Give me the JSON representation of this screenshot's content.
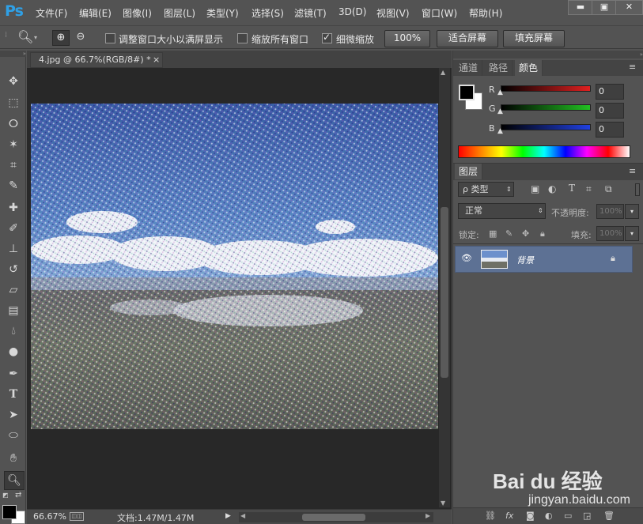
{
  "app": {
    "logo": "Ps"
  },
  "menu": [
    "文件(F)",
    "编辑(E)",
    "图像(I)",
    "图层(L)",
    "类型(Y)",
    "选择(S)",
    "滤镜(T)",
    "3D(D)",
    "视图(V)",
    "窗口(W)",
    "帮助(H)"
  ],
  "window_controls": {
    "minimize": "▬",
    "restore": "▣",
    "close": "✕"
  },
  "options": {
    "resize_windows": "调整窗口大小以满屏显示",
    "zoom_all": "缩放所有窗口",
    "scrubby_zoom": "细微缩放",
    "pct_btn": "100%",
    "fit_btn": "适合屏幕",
    "fill_btn": "填充屏幕"
  },
  "document": {
    "tab_title": "4.jpg @ 66.7%(RGB/8#) *",
    "close": "×"
  },
  "status": {
    "zoom": "66.67%",
    "doc_size": "文档:1.47M/1.47M"
  },
  "color_panel": {
    "tabs": [
      "通道",
      "路径",
      "颜色"
    ],
    "channels": [
      {
        "name": "R",
        "value": "0",
        "color": "#e02020"
      },
      {
        "name": "G",
        "value": "0",
        "color": "#22c022"
      },
      {
        "name": "B",
        "value": "0",
        "color": "#2040e0"
      }
    ]
  },
  "layers_panel": {
    "tab": "图层",
    "kind_filter": "ρ 类型",
    "blend_mode": "正常",
    "opacity_label": "不透明度:",
    "opacity_value": "100%",
    "lock_label": "锁定:",
    "fill_label": "填充:",
    "fill_value": "100%",
    "layers": [
      {
        "name": "背景",
        "visible": true,
        "locked": true
      }
    ]
  },
  "watermark": {
    "brand": "Bai du 经验",
    "url": "jingyan.baidu.com"
  },
  "colors": {
    "ui_bg": "#535353",
    "canvas_bg": "#282828",
    "selected_layer": "#5d7194",
    "accent_logo": "#2fa0e6"
  }
}
